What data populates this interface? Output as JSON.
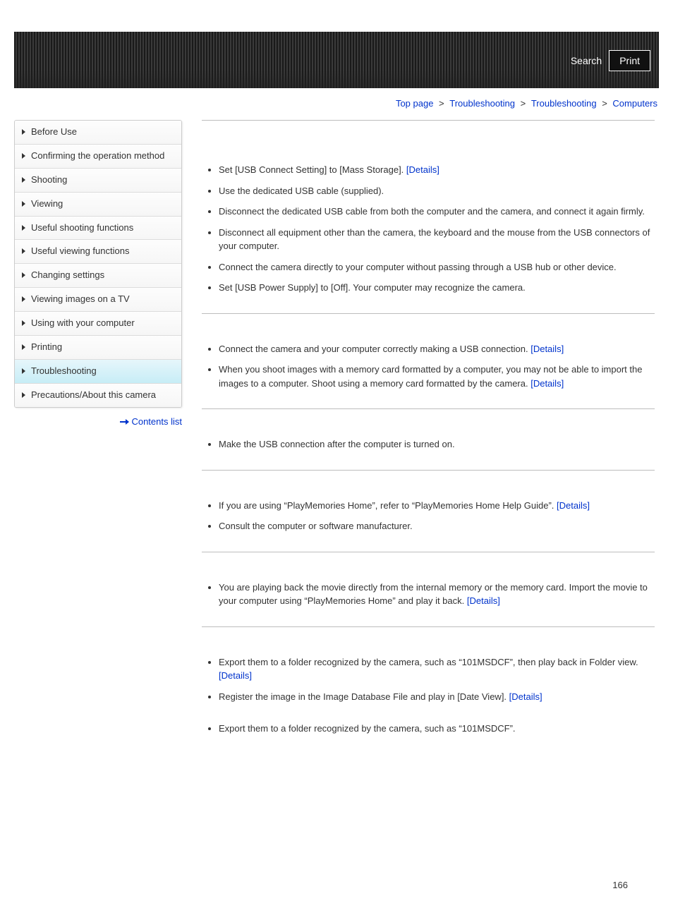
{
  "header": {
    "search_label": "Search",
    "print_label": "Print"
  },
  "breadcrumb": {
    "items": [
      "Top page",
      "Troubleshooting",
      "Troubleshooting",
      "Computers"
    ],
    "sep": ">"
  },
  "sidebar": {
    "items": [
      {
        "label": "Before Use"
      },
      {
        "label": "Confirming the operation method"
      },
      {
        "label": "Shooting"
      },
      {
        "label": "Viewing"
      },
      {
        "label": "Useful shooting functions"
      },
      {
        "label": "Useful viewing functions"
      },
      {
        "label": "Changing settings"
      },
      {
        "label": "Viewing images on a TV"
      },
      {
        "label": "Using with your computer"
      },
      {
        "label": "Printing"
      },
      {
        "label": "Troubleshooting",
        "active": true
      },
      {
        "label": "Precautions/About this camera"
      }
    ],
    "contents_list_label": "Contents list"
  },
  "details_label": "[Details]",
  "sections": [
    {
      "items": [
        {
          "text": "Set [USB Connect Setting] to [Mass Storage]. ",
          "details": true
        },
        {
          "text": "Use the dedicated USB cable (supplied)."
        },
        {
          "text": "Disconnect the dedicated USB cable from both the computer and the camera, and connect it again firmly."
        },
        {
          "text": "Disconnect all equipment other than the camera, the keyboard and the mouse from the USB connectors of your computer."
        },
        {
          "text": "Connect the camera directly to your computer without passing through a USB hub or other device."
        },
        {
          "text": "Set [USB Power Supply] to [Off]. Your computer may recognize the camera."
        }
      ]
    },
    {
      "items": [
        {
          "text": "Connect the camera and your computer correctly making a USB connection. ",
          "details": true
        },
        {
          "text": "When you shoot images with a memory card formatted by a computer, you may not be able to import the images to a computer. Shoot using a memory card formatted by the camera. ",
          "details": true
        }
      ]
    },
    {
      "items": [
        {
          "text": "Make the USB connection after the computer is turned on."
        }
      ]
    },
    {
      "items": [
        {
          "text": "If you are using “PlayMemories Home”, refer to “PlayMemories Home Help Guide”. ",
          "details": true
        },
        {
          "text": "Consult the computer or software manufacturer."
        }
      ]
    },
    {
      "items": [
        {
          "text": "You are playing back the movie directly from the internal memory or the memory card. Import the movie to your computer using “PlayMemories Home” and play it back. ",
          "details": true
        }
      ]
    },
    {
      "items": [
        {
          "text": "Export them to a folder recognized by the camera, such as “101MSDCF”, then play back in Folder view. ",
          "details": true
        },
        {
          "text": "Register the image in the Image Database File and play in [Date View]. ",
          "details": true
        }
      ],
      "extra_gap": true
    },
    {
      "items": [
        {
          "text": "Export them to a folder recognized by the camera, such as “101MSDCF”."
        }
      ],
      "no_rule": true
    }
  ],
  "page_number": "166"
}
